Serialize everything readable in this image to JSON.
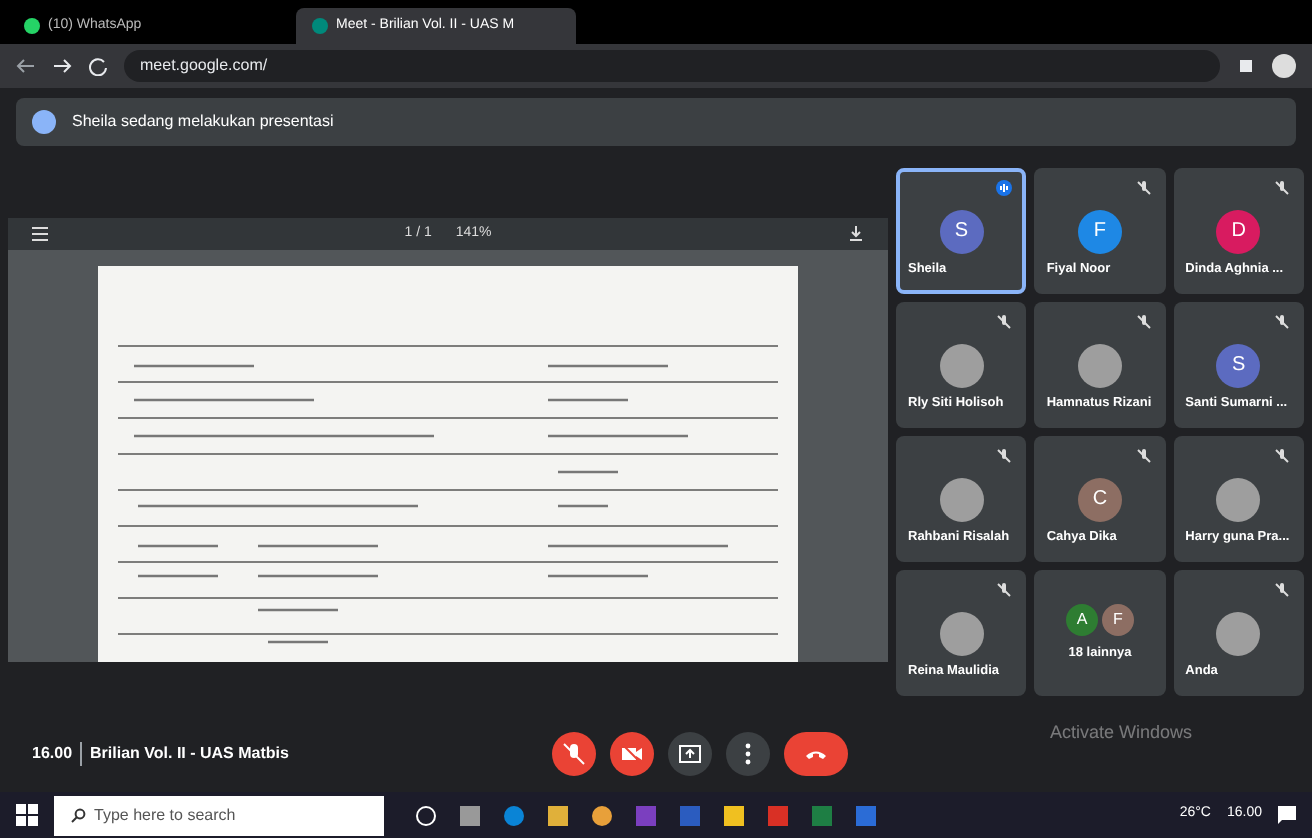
{
  "browser": {
    "tabs": [
      {
        "title": "(10) WhatsApp",
        "selected": false
      },
      {
        "title": "Meet - Brilian Vol. II - UAS M",
        "selected": true
      }
    ],
    "url": "meet.google.com/"
  },
  "banner": {
    "text": "Sheila sedang melakukan presentasi"
  },
  "viewer": {
    "page": "1 / 1",
    "zoom": "141%"
  },
  "participants": [
    {
      "name": "Sheila",
      "kind": "initial",
      "initial": "S",
      "color": "#5c6bc0",
      "selected": true,
      "muted": false
    },
    {
      "name": "Fiyal Noor",
      "kind": "initial",
      "initial": "F",
      "color": "#1e88e5",
      "selected": false,
      "muted": true
    },
    {
      "name": "Dinda Aghnia ...",
      "kind": "initial",
      "initial": "D",
      "color": "#d81b60",
      "selected": false,
      "muted": true
    },
    {
      "name": "Rly Siti Holisoh",
      "kind": "photo",
      "selected": false,
      "muted": true
    },
    {
      "name": "Hamnatus Rizani",
      "kind": "photo",
      "selected": false,
      "muted": true
    },
    {
      "name": "Santi Sumarni ...",
      "kind": "initial",
      "initial": "S",
      "color": "#5c6bc0",
      "selected": false,
      "muted": true
    },
    {
      "name": "Rahbani Risalah",
      "kind": "photo",
      "selected": false,
      "muted": true
    },
    {
      "name": "Cahya Dika",
      "kind": "initial",
      "initial": "C",
      "color": "#8d6e63",
      "selected": false,
      "muted": true
    },
    {
      "name": "Harry guna Pra...",
      "kind": "photo",
      "selected": false,
      "muted": true
    },
    {
      "name": "Reina Maulidia",
      "kind": "photo",
      "selected": false,
      "muted": true
    },
    {
      "name": "18 lainnya",
      "kind": "group",
      "initials": [
        {
          "initial": "A",
          "color": "#2e7d32"
        },
        {
          "initial": "F",
          "color": "#8d6e63"
        }
      ],
      "selected": false
    },
    {
      "name": "Anda",
      "kind": "photo",
      "selected": false,
      "muted": true
    }
  ],
  "meeting": {
    "time": "16.00",
    "title": "Brilian Vol. II - UAS Matbis"
  },
  "controls": [
    {
      "kind": "mic",
      "off": true
    },
    {
      "kind": "camera",
      "off": true
    },
    {
      "kind": "present",
      "off": false
    },
    {
      "kind": "more",
      "off": false
    },
    {
      "kind": "leave"
    }
  ],
  "activation": {
    "text": "Activate Windows"
  },
  "taskbar": {
    "search_placeholder": "Type here to search",
    "weather": "26°C",
    "clock": "16.00"
  }
}
